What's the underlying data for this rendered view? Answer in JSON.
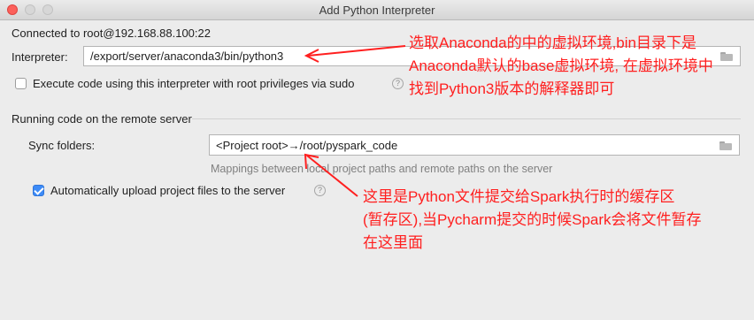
{
  "window": {
    "title": "Add Python Interpreter"
  },
  "connection": {
    "text": "Connected to root@192.168.88.100:22"
  },
  "interpreter": {
    "label": "Interpreter:",
    "value": "/export/server/anaconda3/bin/python3"
  },
  "sudo_option": {
    "label": "Execute code using this interpreter with root privileges via sudo",
    "checked": false
  },
  "remote_section": {
    "title": "Running code on the remote server"
  },
  "sync": {
    "label": "Sync folders:",
    "value": "<Project root>→/root/pyspark_code",
    "hint": "Mappings between local project paths and remote paths on the server"
  },
  "auto_upload": {
    "label": "Automatically upload project files to the server",
    "checked": true
  },
  "help_glyph": "?",
  "icons": {
    "folder": "folder-icon",
    "help": "help-icon"
  },
  "annotations": {
    "top": [
      "选取Anaconda的中的虚拟环境,bin目录下是",
      "Anaconda默认的base虚拟环境, 在虚拟环境中",
      "找到Python3版本的解释器即可"
    ],
    "bottom": [
      "这里是Python文件提交给Spark执行时的缓存区",
      "(暂存区),当Pycharm提交的时候Spark会将文件暂存",
      "在这里面"
    ]
  },
  "colors": {
    "annotation": "#ff1f1f",
    "checkbox_on": "#3d8bf7",
    "close_light": "#fc605b"
  }
}
